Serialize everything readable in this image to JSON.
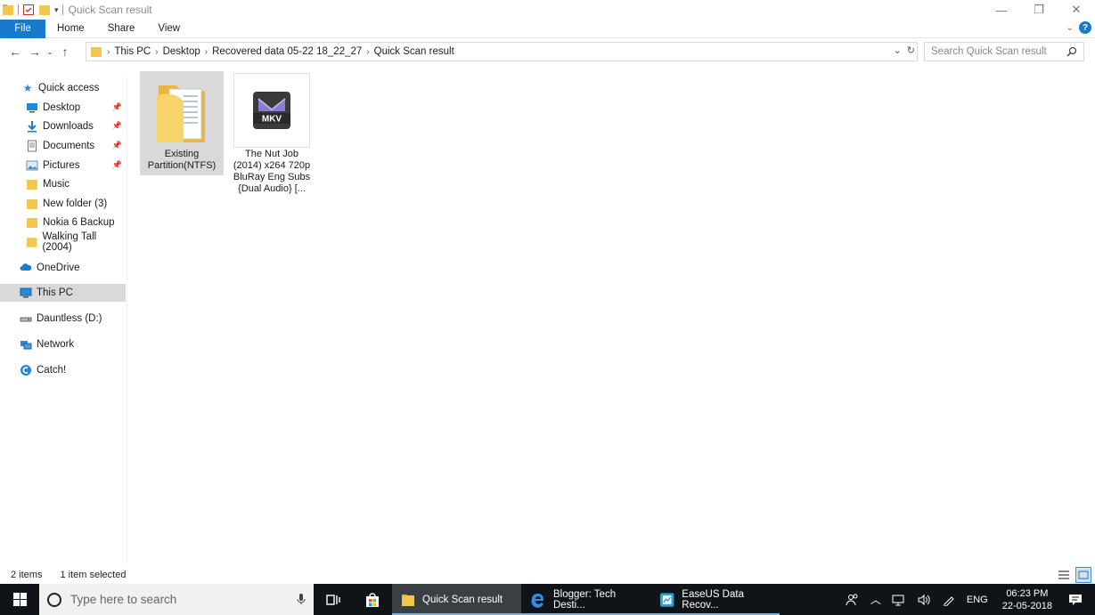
{
  "window": {
    "title": "Quick Scan result",
    "controls": {
      "minimize": "—",
      "restore": "❐",
      "close": "✕"
    }
  },
  "ribbon": {
    "tabs": [
      "File",
      "Home",
      "Share",
      "View"
    ]
  },
  "address": {
    "crumbs": [
      "This PC",
      "Desktop",
      "Recovered data 05-22 18_22_27",
      "Quick Scan result"
    ],
    "search_placeholder": "Search Quick Scan result"
  },
  "navpane": {
    "quick_access": "Quick access",
    "items": [
      {
        "label": "Desktop",
        "icon": "desktop-icon",
        "pinned": true
      },
      {
        "label": "Downloads",
        "icon": "download-icon",
        "pinned": true
      },
      {
        "label": "Documents",
        "icon": "documents-icon",
        "pinned": true
      },
      {
        "label": "Pictures",
        "icon": "pictures-icon",
        "pinned": true
      },
      {
        "label": "Music",
        "icon": "folder-icon",
        "pinned": false
      },
      {
        "label": "New folder (3)",
        "icon": "folder-icon",
        "pinned": false
      },
      {
        "label": "Nokia 6 Backup",
        "icon": "folder-icon",
        "pinned": false
      },
      {
        "label": "Walking Tall (2004)",
        "icon": "folder-icon",
        "pinned": false
      }
    ],
    "onedrive": "OneDrive",
    "this_pc": "This PC",
    "drive": "Dauntless (D:)",
    "network": "Network",
    "catch": "Catch!"
  },
  "files": [
    {
      "name": "Existing Partition(NTFS)",
      "type": "folder",
      "selected": true
    },
    {
      "name": "The Nut Job (2014) x264 720p BluRay Eng Subs {Dual Audio} [...",
      "type": "mkv",
      "badge": "MKV",
      "selected": false
    }
  ],
  "status": {
    "items": "2 items",
    "selected": "1 item selected"
  },
  "taskbar": {
    "search_placeholder": "Type here to search",
    "apps": [
      {
        "label": "Quick Scan result",
        "active": true
      },
      {
        "label": "Blogger: Tech Desti...",
        "active": false
      },
      {
        "label": "EaseUS Data Recov...",
        "active": false
      }
    ],
    "lang": "ENG",
    "time": "06:23 PM",
    "date": "22-05-2018"
  },
  "colors": {
    "accent": "#1979ca",
    "folder": "#f3c74f",
    "taskbar": "#101418",
    "selection": "#d9d9d9"
  }
}
